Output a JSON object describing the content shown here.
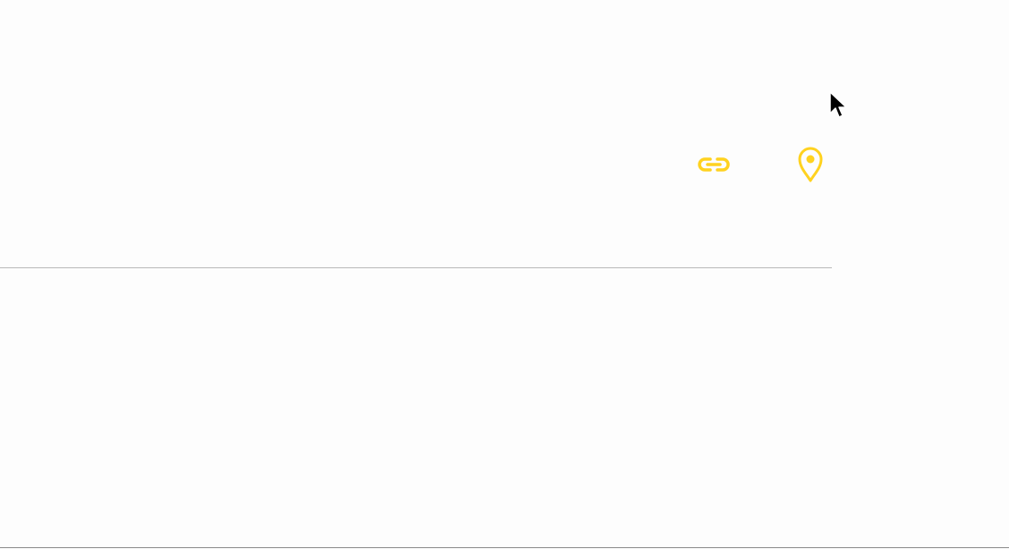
{
  "icons": {
    "accent_color": "#FFD21F",
    "link": "link-icon",
    "location": "map-pin-icon"
  },
  "cursor": "arrow-pointer"
}
